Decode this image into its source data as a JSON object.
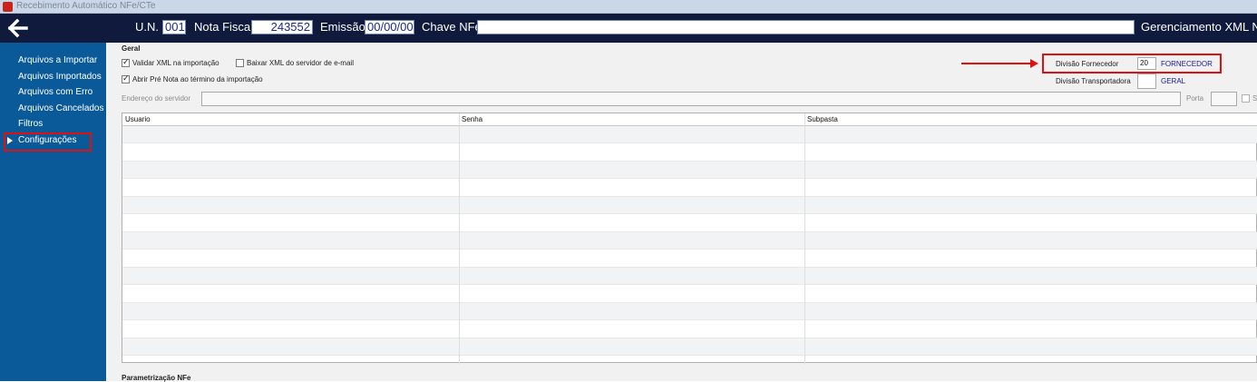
{
  "window": {
    "title": "Recebimento Automático NFe/CTe"
  },
  "header": {
    "un_label": "U.N.",
    "un_value": "001",
    "nota_label": "Nota Fiscal",
    "nota_value": "243552",
    "emissao_label": "Emissão",
    "emissao_value": "00/00/00",
    "chave_label": "Chave NFe",
    "chave_value": "",
    "right_title": "Gerenciamento XML NFe"
  },
  "sidebar": {
    "items": [
      {
        "label": "Arquivos a Importar"
      },
      {
        "label": "Arquivos Importados"
      },
      {
        "label": "Arquivos com Erro"
      },
      {
        "label": "Arquivos Cancelados"
      },
      {
        "label": "Filtros"
      },
      {
        "label": "Configurações",
        "selected": true
      }
    ]
  },
  "geral": {
    "section_title": "Geral",
    "validar_xml": {
      "label": "Validar XML na importação",
      "checked": true
    },
    "baixar_xml": {
      "label": "Baixar XML do servidor de e-mail",
      "checked": false
    },
    "abrir_pre_nota": {
      "label": "Abrir Pré Nota ao término da importação",
      "checked": true
    },
    "divisao_fornecedor": {
      "label": "Divisão Fornecedor",
      "code": "20",
      "name": "FORNECEDOR"
    },
    "divisao_transportadora": {
      "label": "Divisão Transportadora",
      "code": "",
      "name": "GERAL"
    },
    "endereco_servidor": {
      "label": "Endereço do servidor",
      "value": ""
    },
    "porta": {
      "label": "Porta",
      "value": ""
    },
    "ssl_label": "S"
  },
  "grid": {
    "columns": [
      "Usuario",
      "Senha",
      "Subpasta"
    ],
    "rows": [
      [
        "",
        "",
        ""
      ],
      [
        "",
        "",
        ""
      ],
      [
        "",
        "",
        ""
      ],
      [
        "",
        "",
        ""
      ],
      [
        "",
        "",
        ""
      ],
      [
        "",
        "",
        ""
      ],
      [
        "",
        "",
        ""
      ],
      [
        "",
        "",
        ""
      ],
      [
        "",
        "",
        ""
      ],
      [
        "",
        "",
        ""
      ],
      [
        "",
        "",
        ""
      ],
      [
        "",
        "",
        ""
      ],
      [
        "",
        "",
        ""
      ]
    ]
  },
  "parametrizacao": {
    "section_title": "Parametrização NFe"
  },
  "colors": {
    "header_bg": "#0f1a3c",
    "sidebar_bg": "#0a5a9a",
    "highlight_red": "#e01010",
    "value_blue": "#1a1aa0"
  }
}
